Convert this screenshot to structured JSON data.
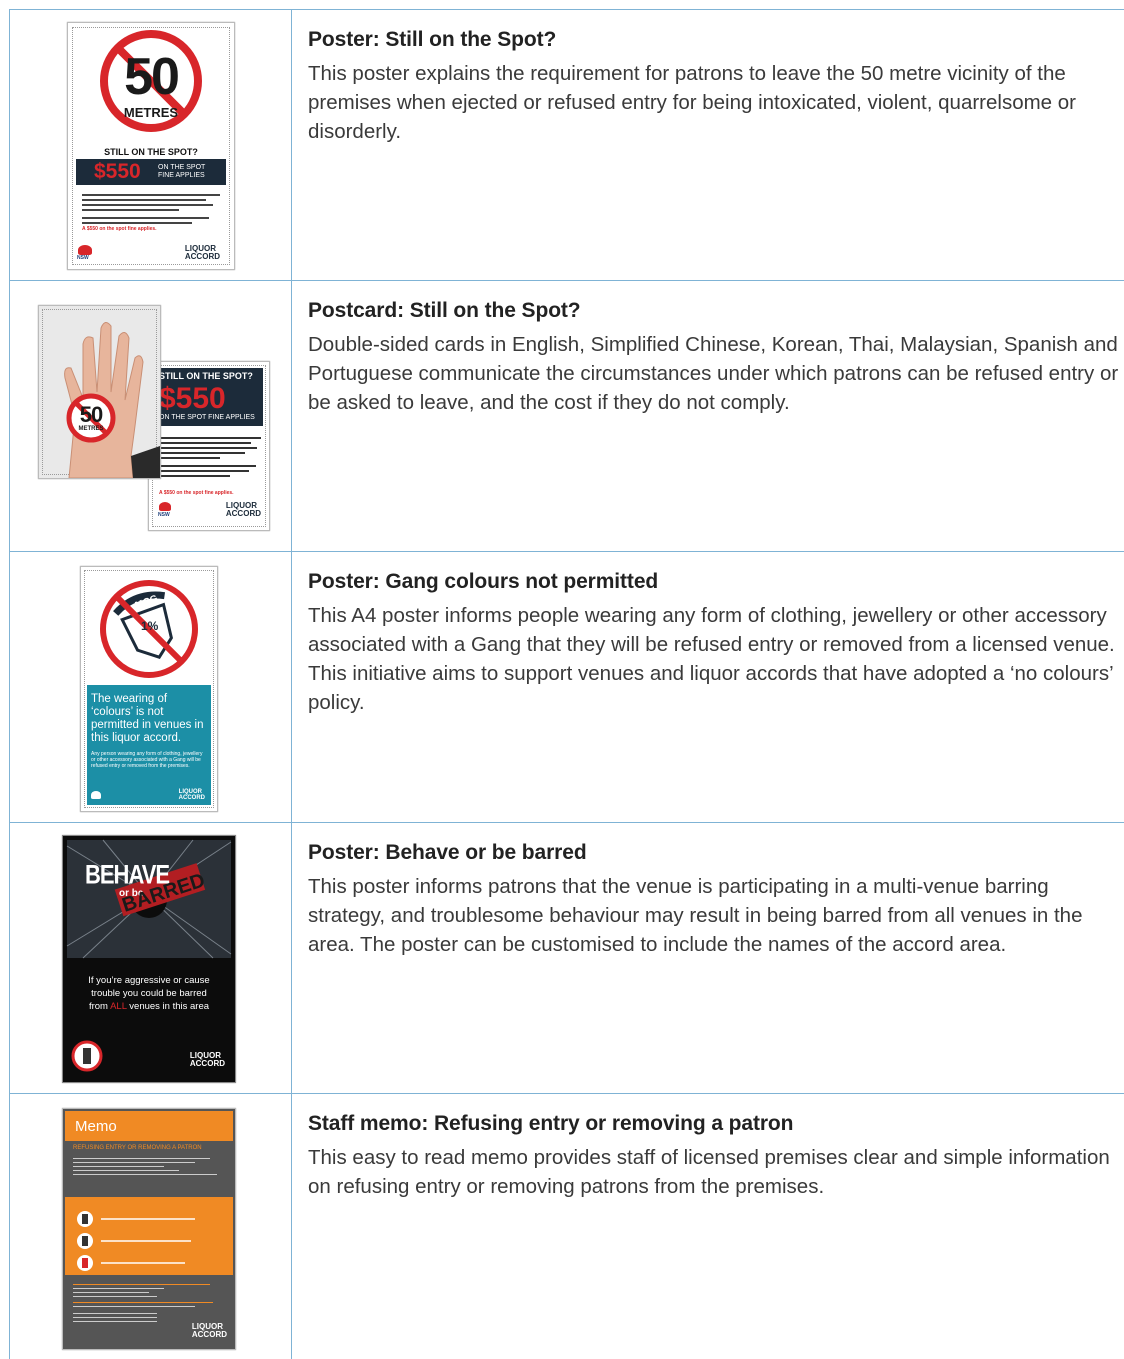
{
  "rows": [
    {
      "title": "Poster: Still on the Spot?",
      "body": "This poster explains the requirement for patrons to leave the 50 metre vicinity of the premises when ejected or refused entry for being intoxicated, violent, quarrelsome or disorderly.",
      "thumb": {
        "number": "50",
        "unit": "METRES",
        "heading": "STILL ON THE SPOT?",
        "fine": "$550",
        "fine_note": "ON THE SPOT FINE APPLIES",
        "note": "A $550 on the spot fine applies."
      }
    },
    {
      "title": "Postcard: Still on the Spot?",
      "body": "Double-sided cards in English, Simplified Chinese, Korean, Thai, Malaysian, Spanish and Portuguese communicate the circumstances under which patrons can be refused entry or be asked to leave, and the cost if they do not comply.",
      "thumb": {
        "number": "50",
        "unit": "METRES",
        "heading": "STILL ON THE SPOT?",
        "fine": "$550",
        "fine_note": "ON THE SPOT FINE APPLIES",
        "note": "A $550 on the spot fine applies."
      }
    },
    {
      "title": "Poster: Gang colours not permitted",
      "body": "This A4 poster informs people wearing any form of clothing, jewellery or other accessory associated with a Gang that they will be refused entry or removed from a licensed venue. This initiative aims to support venues and liquor accords that have adopted a ‘no colours’ policy.",
      "thumb": {
        "patch": "MCG",
        "patch_pct": "1%",
        "text": "The wearing of ‘colours’ is not permitted in venues in this liquor accord.",
        "small": "Any person wearing any form of clothing, jewellery or other accessory associated with a Gang will be refused entry or removed from the premises."
      }
    },
    {
      "title": "Poster: Behave or be barred",
      "body": "This poster informs patrons that the venue is participating in a multi-venue barring strategy, and troublesome behaviour may result in being barred from all venues in the area. The poster can be customised to include the names of the accord area.",
      "thumb": {
        "word1": "BEHAVE",
        "word2": "or be",
        "word3": "BARRED",
        "line1": "If you’re aggressive or cause",
        "line2": "trouble you could be barred",
        "line3_pre": "from",
        "line3_hl": "ALL",
        "line3_post": "venues in this area"
      }
    },
    {
      "title": "Staff memo: Refusing entry or removing a patron",
      "body": "This easy to read memo provides staff of licensed premises clear and simple information on refusing entry or removing patrons from the premises.",
      "thumb": {
        "header": "Memo",
        "sub": "REFUSING ENTRY OR REMOVING A PATRON"
      }
    }
  ],
  "brand": {
    "nsw": "NSW",
    "logo_line1": "LIQU",
    "logo_line2": "ACC",
    "logo_end1": "R",
    "logo_end2": "RD"
  },
  "colors": {
    "divider": "#7fb3d5",
    "red": "#d8262a",
    "navy": "#1c2b3a",
    "teal": "#1c8fa6",
    "orange": "#f08a24",
    "memo_grey": "#555555"
  }
}
